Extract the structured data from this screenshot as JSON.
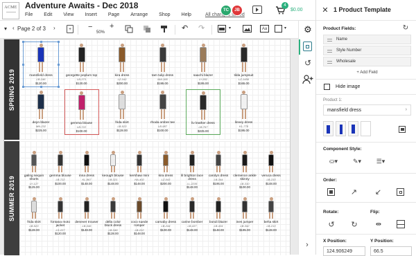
{
  "app": {
    "logo_text": "ACME",
    "title": "Adventure Awaits - Dec 2018",
    "status": "All changes saved",
    "cart_count": "4",
    "cart_amount": "$0.00"
  },
  "menus": [
    "File",
    "Edit",
    "View",
    "Insert",
    "Page",
    "Arrange",
    "Shop",
    "Help"
  ],
  "avatars": [
    {
      "initials": "TC",
      "color": "#2aa86e"
    },
    {
      "initials": "JB",
      "color": "#e0383a"
    }
  ],
  "toolbar": {
    "page_label": "Page 2 of 3",
    "zoom": "50%"
  },
  "sections": [
    {
      "name": "SPRING 2019",
      "rows": [
        [
          {
            "name": "mansfield dress",
            "sku": "LB-246",
            "price": "$120.00",
            "color": "#1a34b8",
            "selected": "sel"
          },
          {
            "name": "georgette peplum top",
            "sku": "LB-373",
            "price": "$120.00",
            "color": "#222"
          },
          {
            "name": "kira dress",
            "sku": "LZ-043",
            "price": "$200.00",
            "color": "#8a5a2a"
          },
          {
            "name": "tam tulip dress",
            "sku": "NW-365",
            "price": "$195.00",
            "color": "#3a3a3a"
          },
          {
            "name": "saachi blazer",
            "sku": "LY-552",
            "price": "$195.00",
            "color": "#9a7b5a"
          },
          {
            "name": "tilda jumpsuit",
            "sku": "LZ-1456",
            "price": "$165.00",
            "color": "#2a2a2a"
          }
        ],
        [
          {
            "name": "deyn blazer",
            "sku": "MN-232",
            "price": "$225.00",
            "color": "#1d2f4a"
          },
          {
            "name": "gemma blouse",
            "sku": "LB-722",
            "price": "$100.00",
            "color": "#c0206a",
            "selected": "hl-red"
          },
          {
            "name": "frida skirt",
            "sku": "LB-523",
            "price": "$128.00",
            "color": "#ddd"
          },
          {
            "name": "rhoda ombre tee",
            "sku": "LB-987",
            "price": "$100.00",
            "color": "#444"
          },
          {
            "name": "liv leather dress",
            "sku": "LB-767",
            "price": "$225.00",
            "color": "#2a2a2a",
            "selected": "hl-green"
          },
          {
            "name": "linney dress",
            "sku": "KL-778",
            "price": "$195.00",
            "color": "#f1f1f1"
          }
        ]
      ]
    },
    {
      "name": "SUMMER 2019",
      "rows": [
        [
          {
            "name": "galing sequin shorts",
            "sku": "LY-127",
            "price": "$125.00",
            "color": "#555"
          },
          {
            "name": "gemma blouse",
            "sku": "LB-722",
            "price": "$100.00",
            "color": "#333"
          },
          {
            "name": "inna dress",
            "sku": "KL-867",
            "price": "$148.00",
            "color": "#111"
          },
          {
            "name": "keough blouse",
            "sku": "LB-321",
            "price": "$148.00",
            "color": "#eee"
          },
          {
            "name": "kershaw mini",
            "sku": "HA-402",
            "price": "$148.00",
            "color": "#333"
          },
          {
            "name": "kira dress",
            "sku": "LZ-043",
            "price": "$200.00",
            "color": "#8a5a2a"
          },
          {
            "name": "lil brighton lace dress",
            "sku": "LL-2235",
            "price": "$148.00",
            "color": "#222"
          },
          {
            "name": "carolyn dress",
            "sku": "LB-344",
            "price": "$195.00",
            "color": "#444"
          },
          {
            "name": "clemence ankle skinny",
            "sku": "LB-310",
            "price": "$100.00",
            "color": "#1a1a1a"
          },
          {
            "name": "veruca dress",
            "sku": "LB-233",
            "price": "$148.00",
            "color": "#111"
          }
        ],
        [
          {
            "name": "frida skirt",
            "sku": "LB-523",
            "price": "$128.00",
            "color": "#ddd"
          },
          {
            "name": "fontana moto jacket",
            "sku": "LS-227",
            "price": "$120.00",
            "color": "#333"
          },
          {
            "name": "denever trouser",
            "sku": "LB-346",
            "price": "$148.00",
            "color": "#222"
          },
          {
            "name": "della color block dress",
            "sku": "LB-349",
            "price": "$128.00",
            "color": "#3a3a3a"
          },
          {
            "name": "coco suede romper",
            "sku": "LB-222",
            "price": "$148.00",
            "color": "#6a4a2a"
          },
          {
            "name": "carnaby dress",
            "sku": "LB-244",
            "price": "$100.00",
            "color": "#111"
          },
          {
            "name": "carine bomber",
            "sku": "LB-437",
            "price": "$148.00",
            "color": "#2a2a2a"
          },
          {
            "name": "bondi blazer",
            "sku": "LB-434",
            "price": "$148.00",
            "color": "#222"
          },
          {
            "name": "ines jumper",
            "sku": "LB-342",
            "price": "$195.00",
            "color": "#333"
          },
          {
            "name": "beha skirt",
            "sku": "LB-213",
            "price": "$148.00",
            "color": "#444"
          }
        ]
      ]
    }
  ],
  "panel": {
    "title": "1 Product Template",
    "fields_label": "Product Fields:",
    "fields": [
      "Name",
      "Style Number",
      "Wholesale"
    ],
    "add_field": "+ Add Field",
    "hide_image": "Hide image",
    "product_label": "Product 1:",
    "product_value": "mansfield dress",
    "component_style": "Component Style:",
    "order": "Order:",
    "rotate": "Rotate:",
    "flip": "Flip:",
    "x_position_label": "X Position:",
    "y_position_label": "Y Position:",
    "x_position": "124.906249",
    "y_position": "66.5"
  }
}
